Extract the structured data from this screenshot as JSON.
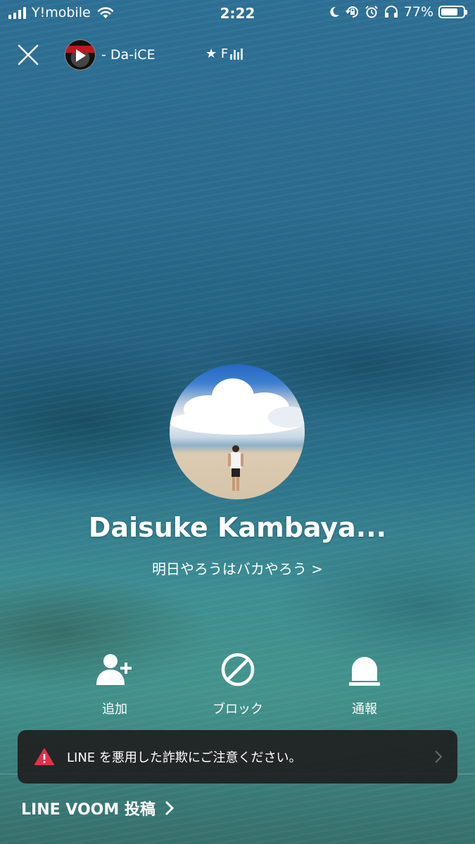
{
  "status_bar": {
    "carrier": "Y!mobile",
    "time": "2:22",
    "battery_percent": "77%",
    "battery_level": 0.77
  },
  "top_bar": {
    "close_icon": "close-icon",
    "music_title": "- Da-iCE",
    "music_rank": "★ F"
  },
  "profile": {
    "name": "Daisuke Kambaya...",
    "status_message": "明日やろうはバカやろう >"
  },
  "actions": [
    {
      "label": "追加",
      "icon": "add-friend-icon"
    },
    {
      "label": "ブロック",
      "icon": "block-icon"
    },
    {
      "label": "通報",
      "icon": "report-icon"
    }
  ],
  "warning": {
    "text": "LINE を悪用した詐欺にご注意ください。",
    "icon": "warning-icon",
    "color": "#e0314a"
  },
  "voom": {
    "label": "LINE VOOM 投稿"
  }
}
